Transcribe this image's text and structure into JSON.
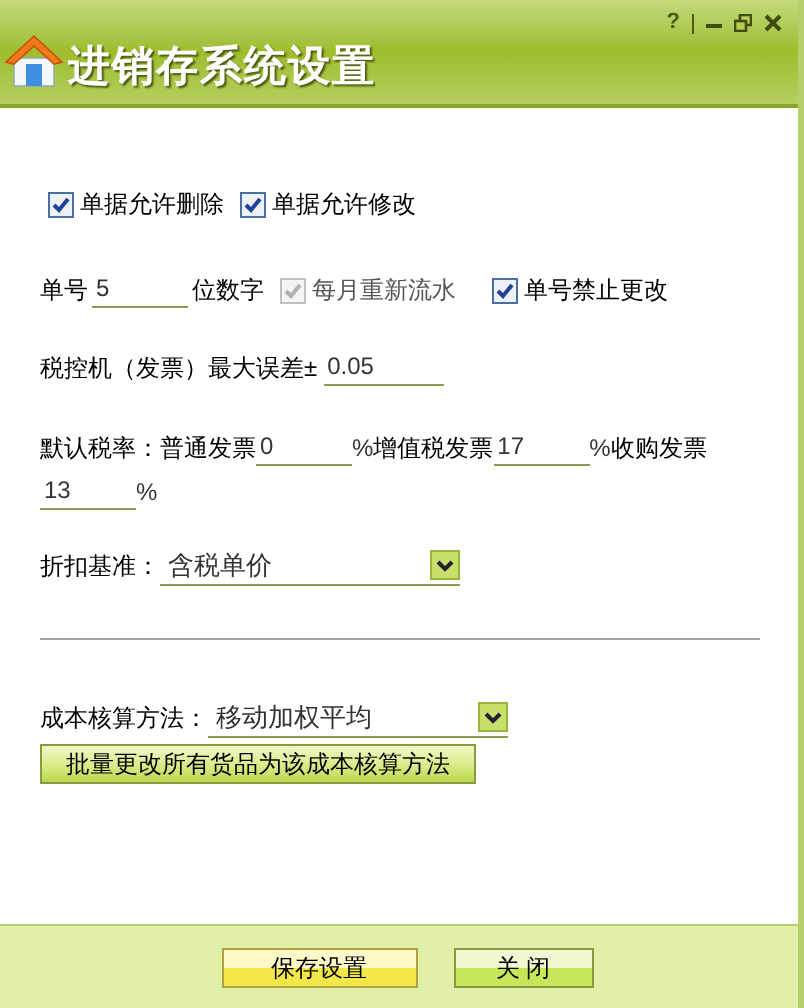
{
  "window": {
    "title": "进销存系统设置",
    "help": "?"
  },
  "options": [
    {
      "label": "单据允许删除",
      "checked": true,
      "disabled": false
    },
    {
      "label": "单据允许修改",
      "checked": true,
      "disabled": false
    }
  ],
  "number_row": {
    "label": "单号",
    "value": "5",
    "suffix": "位数字",
    "options": [
      {
        "label": "每月重新流水",
        "checked": true,
        "disabled": true
      },
      {
        "label": "单号禁止更改",
        "checked": true,
        "disabled": false
      }
    ]
  },
  "tolerance": {
    "label": "税控机（发票）最大误差±",
    "value": "0.05"
  },
  "tax_rates": {
    "label": "默认税率：",
    "items": [
      {
        "label": "普通发票",
        "value": "0",
        "unit": "%"
      },
      {
        "label": "增值税发票",
        "value": "17",
        "unit": "%"
      },
      {
        "label": "收购发票",
        "value": "13",
        "unit": "%"
      }
    ]
  },
  "discount": {
    "label": "折扣基准：",
    "value": "含税单价"
  },
  "cost": {
    "label": "成本核算方法：",
    "value": "移动加权平均",
    "button": "批量更改所有货品为该成本核算方法"
  },
  "footer_buttons": [
    {
      "label": "保存设置",
      "kind": "primary"
    },
    {
      "label": "关 闭",
      "kind": "secondary"
    }
  ]
}
